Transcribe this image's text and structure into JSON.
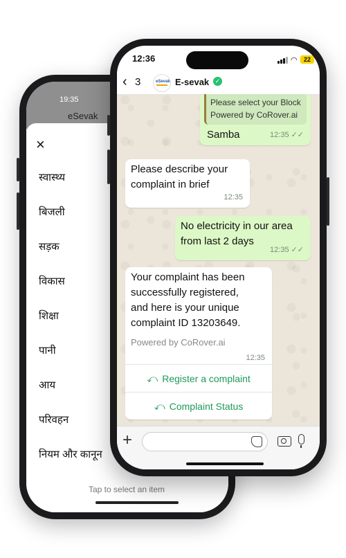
{
  "back_phone": {
    "time": "19:35",
    "title": "eSevak",
    "close_label": "×",
    "menu_items": [
      "स्वास्थ्य",
      "बिजली",
      "सड़क",
      "विकास",
      "शिक्षा",
      "पानी",
      "आय",
      "परिवहन",
      "नियम और कानून"
    ],
    "hint": "Tap to select an item"
  },
  "front_phone": {
    "status": {
      "time": "12:36",
      "battery": "22"
    },
    "header": {
      "back_count": "3",
      "avatar_text": "eSevak",
      "contact_name": "E-sevak"
    },
    "messages": [
      {
        "dir": "out",
        "quote_line1": "Please select your Block",
        "quote_line2": "Powered by CoRover.ai",
        "text": "Samba",
        "time": "12:35"
      },
      {
        "dir": "in",
        "text_line1": "Please describe your",
        "text_line2": "complaint in brief",
        "time": "12:35"
      },
      {
        "dir": "out",
        "text_line1": "No electricity in our area",
        "text_line2": "from last 2 days",
        "time": "12:35"
      },
      {
        "dir": "in",
        "text_line1": "Your complaint has been",
        "text_line2": "successfully registered,",
        "text_line3": "and here is your unique",
        "text_line4": "complaint ID 13203649.",
        "footer": "Powered by CoRover.ai",
        "time": "12:35",
        "buttons": [
          "Register a complaint",
          "Complaint Status"
        ]
      }
    ],
    "composer": {
      "placeholder": ""
    }
  },
  "colors": {
    "outgoing_bubble": "#dcf8c6",
    "incoming_bubble": "#ffffff",
    "accent_green": "#1e9a58",
    "wallpaper": "#ece5da"
  }
}
